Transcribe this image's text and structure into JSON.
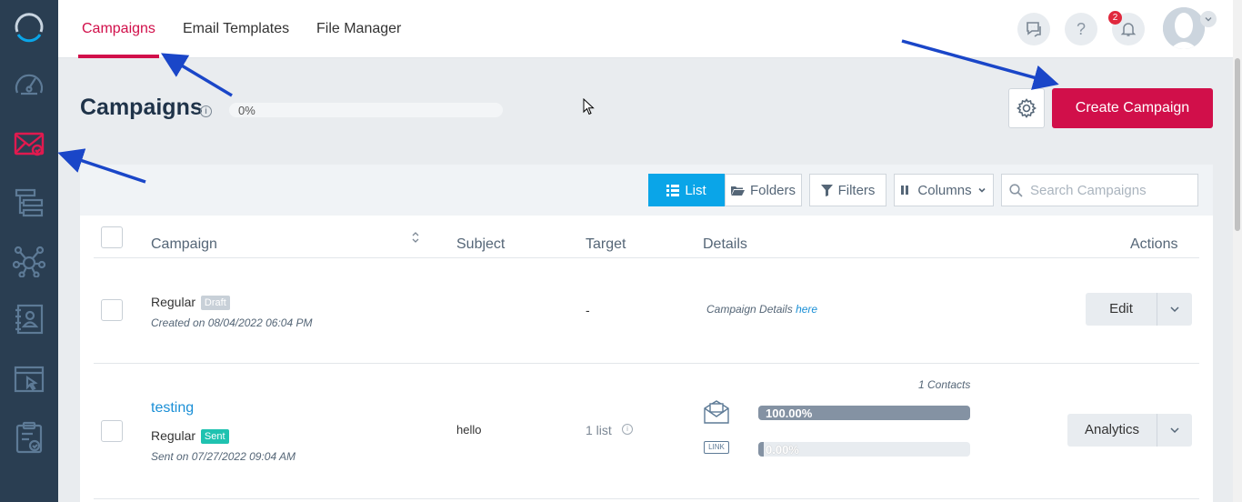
{
  "header": {
    "tabs": [
      {
        "label": "Campaigns",
        "active": true
      },
      {
        "label": "Email Templates",
        "active": false
      },
      {
        "label": "File Manager",
        "active": false
      }
    ],
    "notification_count": "2"
  },
  "sidebar": {
    "items": [
      "logo-icon",
      "dashboard-icon",
      "email-campaigns-icon",
      "automation-icon",
      "network-icon",
      "contacts-icon",
      "landing-page-icon",
      "forms-icon"
    ],
    "active_item": "email-campaigns-icon"
  },
  "page": {
    "title": "Campaigns",
    "progress_label": "0%",
    "create_button": "Create Campaign"
  },
  "toolbar": {
    "list_label": "List",
    "folders_label": "Folders",
    "filters_label": "Filters",
    "columns_label": "Columns",
    "search_placeholder": "Search Campaigns"
  },
  "table": {
    "headers": {
      "campaign": "Campaign",
      "subject": "Subject",
      "target": "Target",
      "details": "Details",
      "actions": "Actions"
    },
    "rows": [
      {
        "type": "Regular",
        "status": "Draft",
        "date": "Created on 08/04/2022 06:04 PM",
        "target": "-",
        "details_text": "Campaign Details",
        "details_link": "here",
        "action": "Edit"
      },
      {
        "name": "testing",
        "type": "Regular",
        "status": "Sent",
        "date": "Sent on 07/27/2022 09:04 AM",
        "subject": "hello",
        "target": "1 list",
        "contacts": "1 Contacts",
        "open_rate_label": "100.00%",
        "open_rate": 1.0,
        "click_rate_label": "0.00%",
        "click_rate": 0.0,
        "click_icon_text": "LINK",
        "action": "Analytics"
      }
    ]
  },
  "colors": {
    "accent": "#d10f4a",
    "sidebar": "#2a3e52",
    "primary": "#0aa5e8",
    "draft": "#c8d0d8",
    "sent": "#1fc2b0",
    "annotation_arrow": "#1a46c8"
  }
}
